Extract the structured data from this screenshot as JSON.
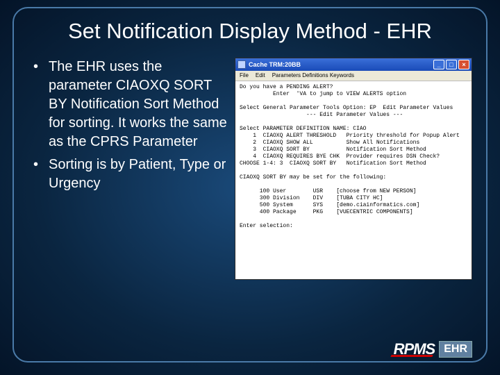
{
  "title": "Set Notification Display Method - EHR",
  "bullets": [
    "The EHR uses the parameter CIAOXQ SORT BY Notification Sort Method for sorting.  It works the same as the CPRS Parameter",
    "Sorting is by Patient, Type or Urgency"
  ],
  "win": {
    "title": "Cache TRM:20BB",
    "menu": {
      "file": "File",
      "edit": "Edit",
      "params": "Parameters  Definitions  Keywords"
    }
  },
  "term": {
    "l1": "Do you have a PENDING ALERT?",
    "l2": "          Enter  'VA to jump to VIEW ALERTS option",
    "l3": "",
    "l4": "Select General Parameter Tools Option: EP  Edit Parameter Values",
    "l5": "                    --- Edit Parameter Values ---",
    "l6": "",
    "l7": "Select PARAMETER DEFINITION NAME: CIAO",
    "l8": "    1  CIAOXQ ALERT THRESHOLD   Priority threshold for Popup Alert",
    "l9": "    2  CIAOXQ SHOW ALL          Show All Notifications",
    "l10": "    3  CIAOXQ SORT BY           Notification Sort Method",
    "l11": "    4  CIAOXQ REQUIRES BYE CHK  Provider requires DSN Check?",
    "l12": "CHOOSE 1-4: 3  CIAOXQ SORT BY   Notification Sort Method",
    "l13": "",
    "l14": "CIAOXQ SORT BY may be set for the following:",
    "l15": "",
    "l16": "      100 User        USR    [choose from NEW PERSON]",
    "l17": "      300 Division    DIV    [TUBA CITY HC]",
    "l18": "      500 System      SYS    [demo.ciainformatics.com]",
    "l19": "      400 Package     PKG    [VUECENTRIC COMPONENTS]",
    "l20": "",
    "l21": "Enter selection:"
  },
  "logo": {
    "rpms": "RPMS",
    "ehr": "EHR"
  }
}
